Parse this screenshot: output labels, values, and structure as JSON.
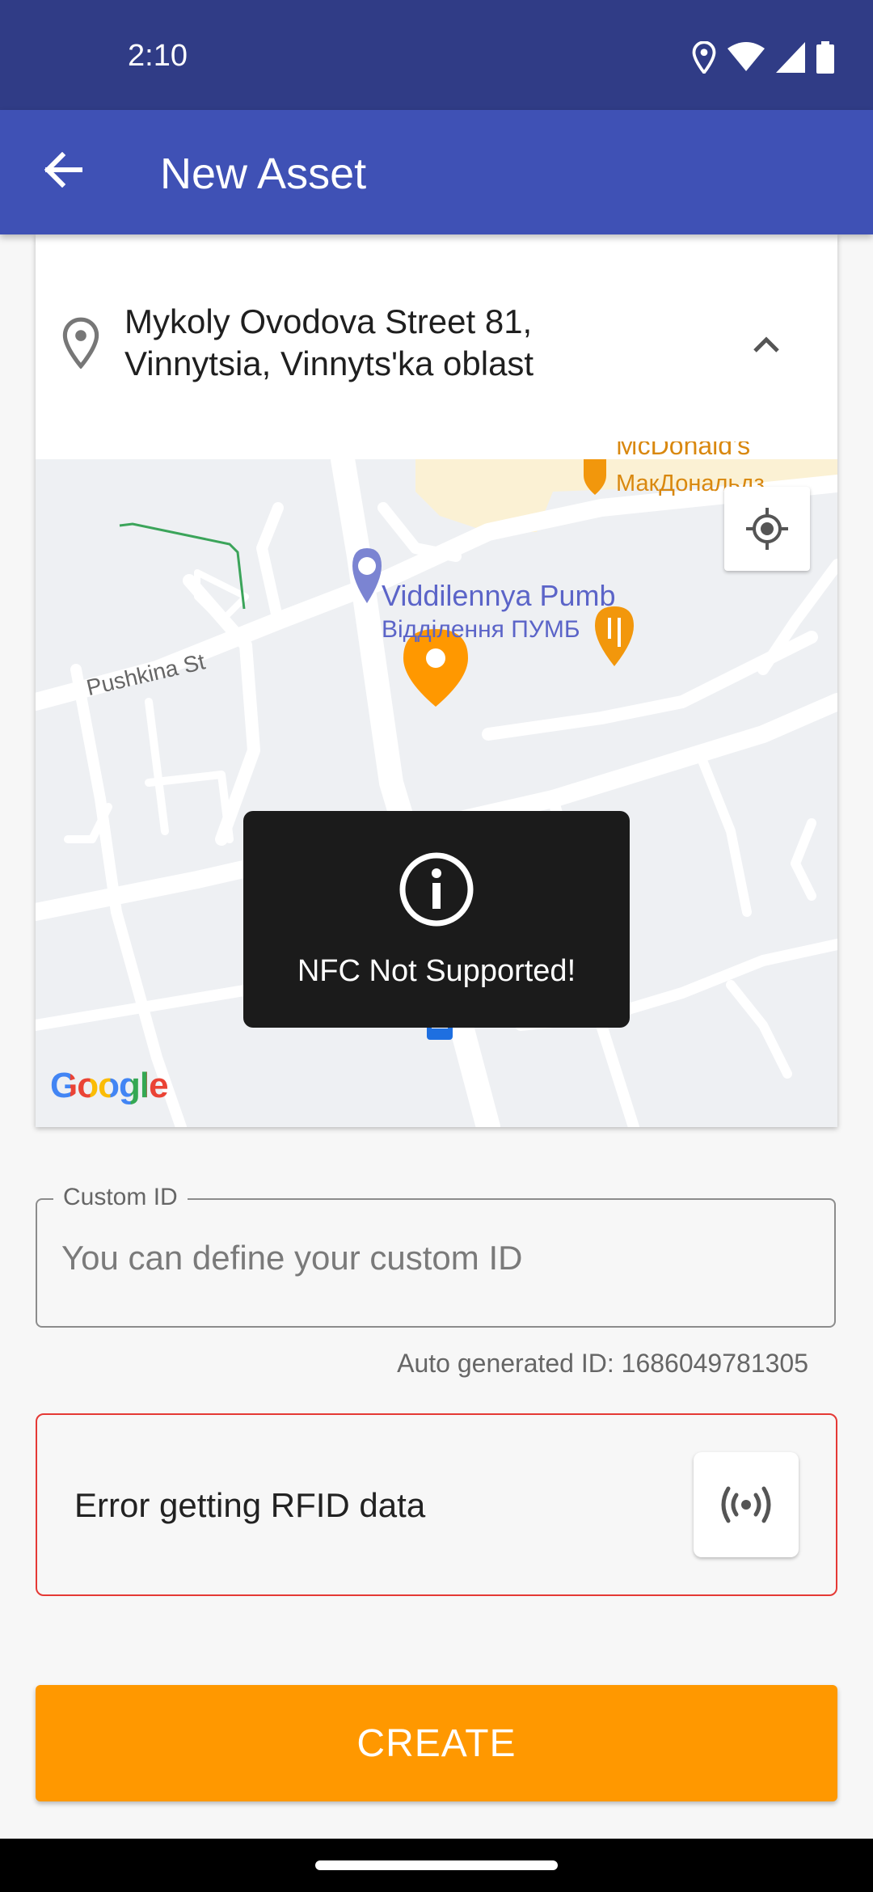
{
  "status_bar": {
    "time": "2:10"
  },
  "app_bar": {
    "title": "New Asset"
  },
  "location": {
    "address_line1": "Mykoly Ovodova Street 81,",
    "address_line2": "Vinnytsia, Vinnyts'ka oblast"
  },
  "map": {
    "labels": {
      "mcdonalds_top": "McDonald's",
      "mcdonalds": "МакДональдз",
      "poi_name": "Viddilennya Pumb",
      "poi_name_local": "Відділення ПУМБ",
      "street": "Pushkina St"
    },
    "brand": "Google"
  },
  "toast": {
    "message": "NFC Not Supported!"
  },
  "custom_id": {
    "label": "Custom ID",
    "placeholder": "You can define your custom ID",
    "value": "",
    "helper": "Auto generated ID: 1686049781305"
  },
  "rfid": {
    "message": "Error getting RFID data"
  },
  "actions": {
    "create_label": "CREATE"
  },
  "colors": {
    "status_bar": "#303c86",
    "app_bar": "#3f51b5",
    "accent": "#ff9800",
    "error": "#e53935"
  }
}
